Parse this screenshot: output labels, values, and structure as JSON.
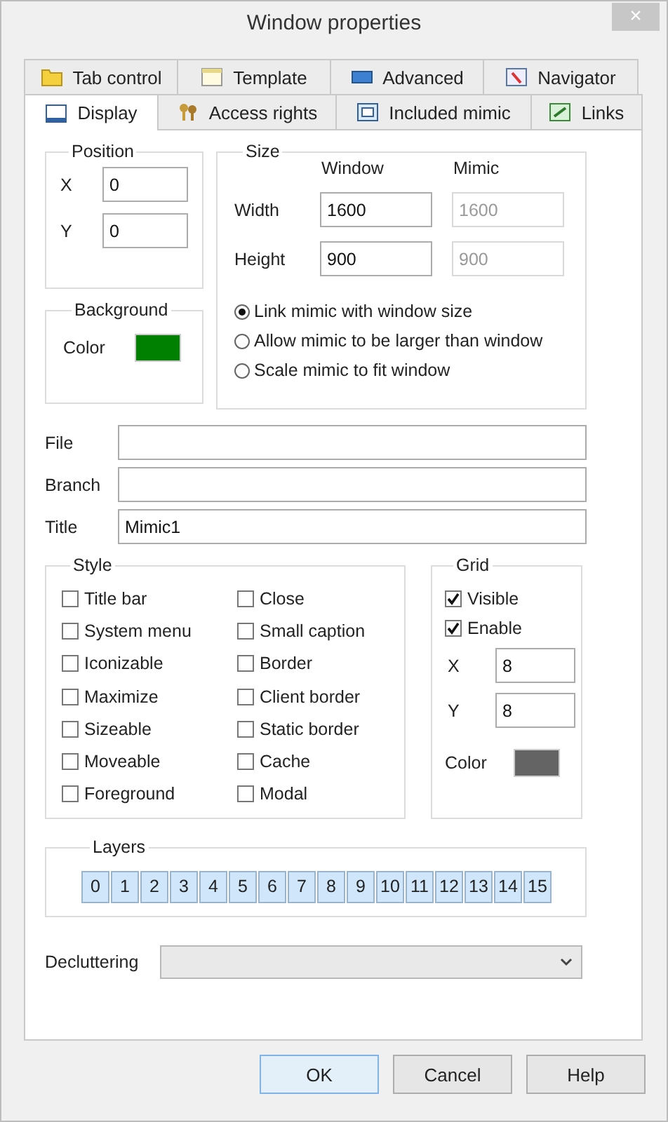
{
  "window": {
    "title": "Window properties",
    "close_button": "×"
  },
  "tab_rows": [
    {
      "tabs": [
        {
          "label": "Tab control",
          "selected": false
        },
        {
          "label": "Template",
          "selected": false
        },
        {
          "label": "Advanced",
          "selected": false
        },
        {
          "label": "Navigator",
          "selected": false
        }
      ]
    },
    {
      "tabs": [
        {
          "label": "Display",
          "selected": true
        },
        {
          "label": "Access rights",
          "selected": false
        },
        {
          "label": "Included mimic",
          "selected": false
        },
        {
          "label": "Links",
          "selected": false
        }
      ]
    }
  ],
  "position": {
    "title": "Position",
    "fields": [
      {
        "label": "X",
        "value": "0"
      },
      {
        "label": "Y",
        "value": "0"
      }
    ]
  },
  "size": {
    "title": "Size",
    "columns": [
      "Window",
      "Mimic"
    ],
    "rows": [
      {
        "label": "Width",
        "fields": [
          {
            "value": "1600",
            "disabled": false
          },
          {
            "value": "1600",
            "disabled": true
          }
        ]
      },
      {
        "label": "Height",
        "fields": [
          {
            "value": "900",
            "disabled": false
          },
          {
            "value": "900",
            "disabled": true
          }
        ]
      }
    ],
    "options": [
      {
        "label": "Link mimic with window size",
        "selected": true
      },
      {
        "label": "Allow mimic to be larger than window",
        "selected": false
      },
      {
        "label": "Scale mimic to fit window",
        "selected": false
      }
    ]
  },
  "background": {
    "title": "Background",
    "label": "Color",
    "color": "#008000"
  },
  "fields": [
    {
      "label": "File"
    },
    {
      "label": "Branch"
    },
    {
      "label": "Title",
      "value": "Mimic1"
    }
  ],
  "style": {
    "title": "Style",
    "options": [
      {
        "label": "Title bar",
        "checked": false
      },
      {
        "label": "System menu",
        "checked": false
      },
      {
        "label": "Iconizable",
        "checked": false
      },
      {
        "label": "Maximize",
        "checked": false
      },
      {
        "label": "Sizeable",
        "checked": false
      },
      {
        "label": "Moveable",
        "checked": false
      },
      {
        "label": "Foreground",
        "checked": false
      },
      {
        "label": "Close",
        "checked": false
      },
      {
        "label": "Small caption",
        "checked": false
      },
      {
        "label": "Border",
        "checked": false
      },
      {
        "label": "Client border",
        "checked": false
      },
      {
        "label": "Static border",
        "checked": false
      },
      {
        "label": "Cache",
        "checked": false
      },
      {
        "label": "Modal",
        "checked": false
      }
    ]
  },
  "grid": {
    "title": "Grid",
    "options": [
      {
        "label": "Visible",
        "checked": true
      },
      {
        "label": "Enable",
        "checked": true
      }
    ],
    "fields": [
      {
        "label": "X",
        "value": "8"
      },
      {
        "label": "Y",
        "value": "8"
      }
    ],
    "color_label": "Color",
    "color": "#646464"
  },
  "layers": {
    "title": "Layers",
    "items": [
      {
        "label": "0",
        "on": true
      },
      {
        "label": "1",
        "on": true
      },
      {
        "label": "2",
        "on": true
      },
      {
        "label": "3",
        "on": true
      },
      {
        "label": "4",
        "on": true
      },
      {
        "label": "5",
        "on": true
      },
      {
        "label": "6",
        "on": true
      },
      {
        "label": "7",
        "on": true
      },
      {
        "label": "8",
        "on": true
      },
      {
        "label": "9",
        "on": true
      },
      {
        "label": "10",
        "on": true
      },
      {
        "label": "11",
        "on": true
      },
      {
        "label": "12",
        "on": true
      },
      {
        "label": "13",
        "on": true
      },
      {
        "label": "14",
        "on": true
      },
      {
        "label": "15",
        "on": true
      }
    ]
  },
  "decluttering": {
    "label": "Decluttering"
  },
  "buttons": [
    {
      "label": "OK",
      "default": true
    },
    {
      "label": "Cancel",
      "default": false
    },
    {
      "label": "Help",
      "default": false
    }
  ]
}
